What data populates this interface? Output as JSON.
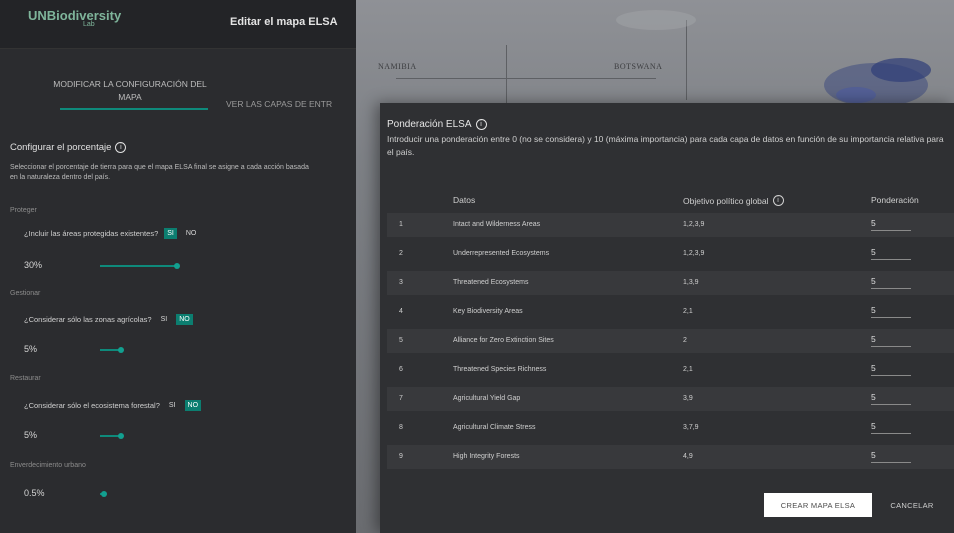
{
  "sidebar": {
    "logo_brand": "UNBiodiversity",
    "logo_sub": "Lab",
    "title": "Editar el mapa ELSA",
    "tabs": [
      "MODIFICAR LA CONFIGURACIÓN DEL MAPA",
      "VER LAS CAPAS DE ENTR"
    ],
    "section_title": "Configurar el porcentaje",
    "section_desc": "Seleccionar el porcentaje de tierra para que el mapa ELSA final se asigne a cada acción basada en la naturaleza dentro del país.",
    "groups": [
      {
        "label": "Proteger",
        "question": "¿Incluir las áreas protegidas existentes?",
        "yes": "SI",
        "no": "NO",
        "selected": "yes",
        "percent": "30%",
        "level": 30
      },
      {
        "label": "Gestionar",
        "question": "¿Considerar sólo las zonas agrícolas?",
        "yes": "SI",
        "no": "NO",
        "selected": "no",
        "percent": "5%",
        "level": 5
      },
      {
        "label": "Restaurar",
        "question": "¿Considerar sólo el ecosistema forestal?",
        "yes": "SI",
        "no": "NO",
        "selected": "no",
        "percent": "5%",
        "level": 5
      },
      {
        "label": "Enverdecimiento urbano",
        "percent": "0.5%",
        "level": 0.5
      }
    ]
  },
  "map": {
    "labels": [
      "NAMIBIA",
      "BOTSWANA"
    ]
  },
  "dialog": {
    "title": "Ponderación ELSA",
    "description": "Introducir una ponderación entre 0 (no se considera) y 10 (máxima importancia) para cada capa de datos en función de su importancia relativa para el país.",
    "headers": {
      "data": "Datos",
      "goal": "Objetivo político global",
      "weight": "Ponderación"
    },
    "rows": [
      {
        "num": "1",
        "data": "Intact and Wilderness Areas",
        "goal": "1,2,3,9",
        "weight": "5"
      },
      {
        "num": "2",
        "data": "Underrepresented Ecosystems",
        "goal": "1,2,3,9",
        "weight": "5"
      },
      {
        "num": "3",
        "data": "Threatened Ecosystems",
        "goal": "1,3,9",
        "weight": "5"
      },
      {
        "num": "4",
        "data": "Key Biodiversity Areas",
        "goal": "2,1",
        "weight": "5"
      },
      {
        "num": "5",
        "data": "Alliance for Zero Extinction Sites",
        "goal": "2",
        "weight": "5"
      },
      {
        "num": "6",
        "data": "Threatened Species Richness",
        "goal": "2,1",
        "weight": "5"
      },
      {
        "num": "7",
        "data": "Agricultural Yield Gap",
        "goal": "3,9",
        "weight": "5"
      },
      {
        "num": "8",
        "data": "Agricultural Climate Stress",
        "goal": "3,7,9",
        "weight": "5"
      },
      {
        "num": "9",
        "data": "High Integrity Forests",
        "goal": "4,9",
        "weight": "5"
      }
    ],
    "create_label": "CREAR MAPA ELSA",
    "cancel_label": "CANCELAR"
  },
  "colors": {
    "accent": "#0c7e70",
    "panel": "#2f3033",
    "sidebar": "#2b2c2f"
  }
}
